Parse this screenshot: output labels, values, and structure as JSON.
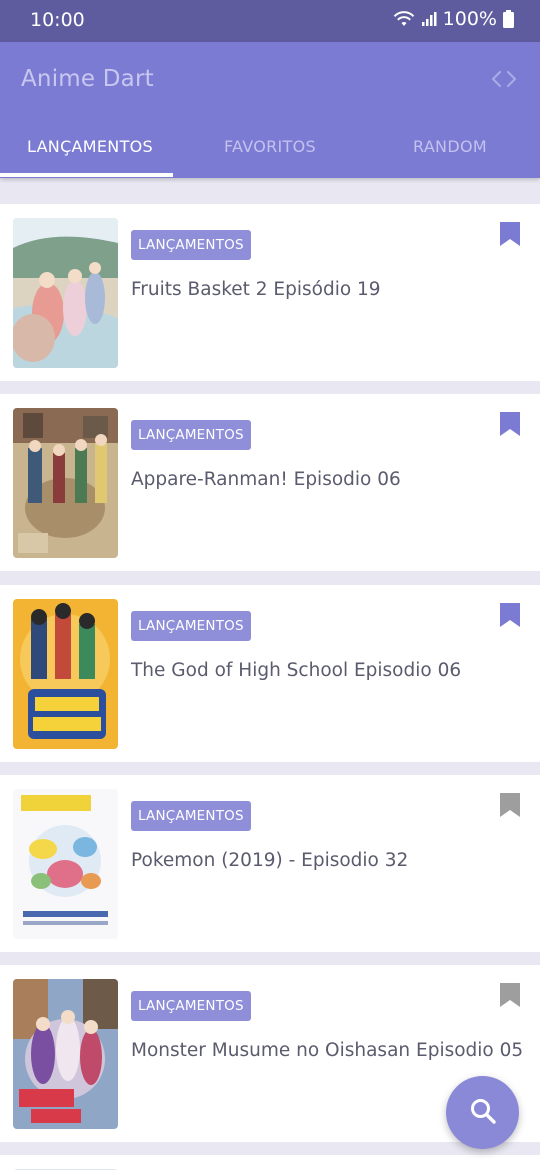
{
  "status_bar": {
    "time": "10:00",
    "battery": "100%"
  },
  "app_bar": {
    "title": "Anime Dart",
    "code_icon": "code-icon"
  },
  "tabs": [
    {
      "label": "LANÇAMENTOS",
      "active": true
    },
    {
      "label": "FAVORITOS",
      "active": false
    },
    {
      "label": "RANDOM",
      "active": false
    }
  ],
  "episodes": [
    {
      "tag": "LANÇAMENTOS",
      "title": "Fruits Basket 2 Episódio 19",
      "bookmarked": true
    },
    {
      "tag": "LANÇAMENTOS",
      "title": "Appare-Ranman! Episodio 06",
      "bookmarked": true
    },
    {
      "tag": "LANÇAMENTOS",
      "title": "The God of High School Episodio 06",
      "bookmarked": true
    },
    {
      "tag": "LANÇAMENTOS",
      "title": "Pokemon (2019) - Episodio 32",
      "bookmarked": false
    },
    {
      "tag": "LANÇAMENTOS",
      "title": "Monster Musume no Oishasan Episodio 05",
      "bookmarked": false
    }
  ],
  "fab": {
    "icon": "search-icon"
  },
  "colors": {
    "primary": "#7c7bd4",
    "status_bar": "#5e5c9f",
    "badge": "#8f8ed8",
    "bookmark_active": "#7c7bd4",
    "bookmark_inactive": "#9e9e9e"
  }
}
